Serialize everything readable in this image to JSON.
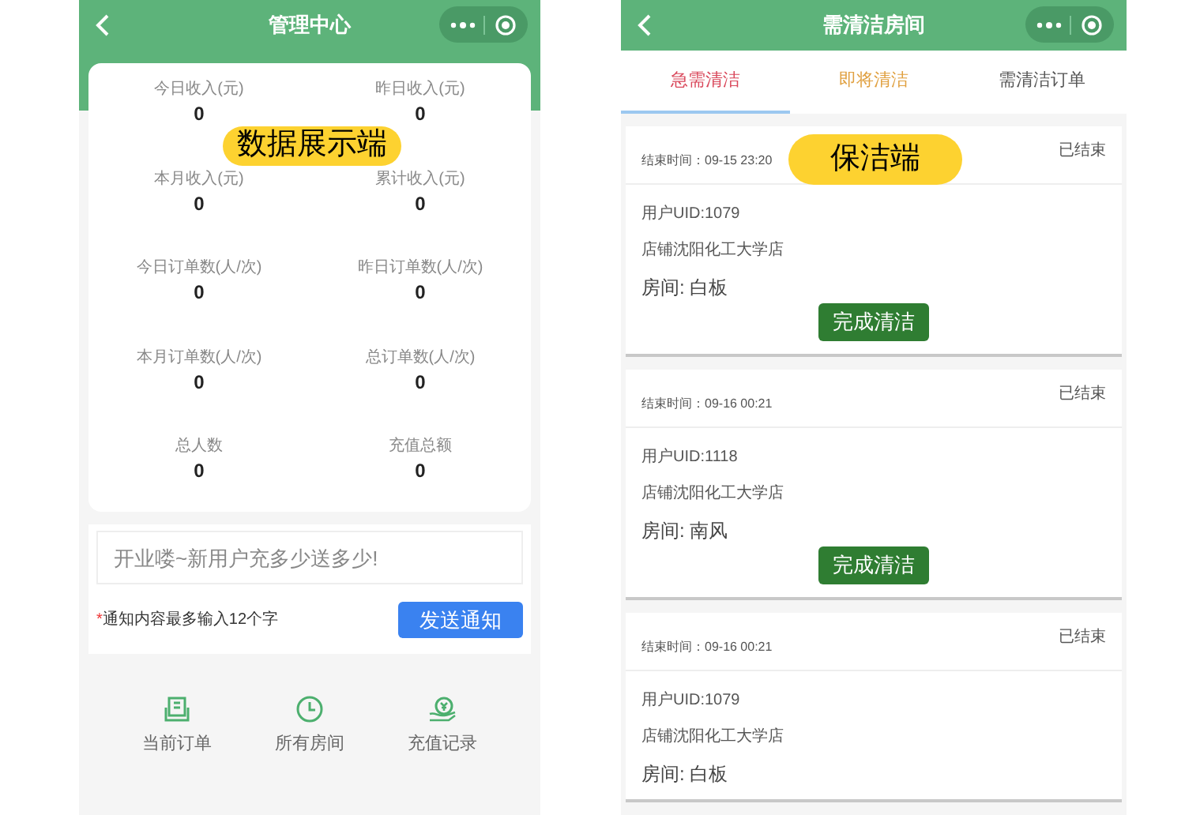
{
  "admin_screen": {
    "title": "管理中心",
    "badge": "数据展示端",
    "stats": [
      {
        "label": "今日收入(元)",
        "value": "0"
      },
      {
        "label": "昨日收入(元)",
        "value": "0"
      },
      {
        "label": "本月收入(元)",
        "value": "0"
      },
      {
        "label": "累计收入(元)",
        "value": "0"
      },
      {
        "label": "今日订单数(人/次)",
        "value": "0"
      },
      {
        "label": "昨日订单数(人/次)",
        "value": "0"
      },
      {
        "label": "本月订单数(人/次)",
        "value": "0"
      },
      {
        "label": "总订单数(人/次)",
        "value": "0"
      },
      {
        "label": "总人数",
        "value": "0"
      },
      {
        "label": "充值总额",
        "value": "0"
      }
    ],
    "notice": {
      "placeholder": "开业喽~新用户充多少送多少!",
      "required_mark": "*",
      "hint": "通知内容最多输入12个字",
      "button": "发送通知"
    },
    "nav": [
      {
        "kind": "orders",
        "label": "当前订单"
      },
      {
        "kind": "rooms",
        "label": "所有房间"
      },
      {
        "kind": "recharge",
        "label": "充值记录"
      }
    ]
  },
  "cleaner_screen": {
    "title": "需清洁房间",
    "badge": "保洁端",
    "tabs": [
      {
        "label": "急需清洁",
        "selected": true,
        "color": "#d9475a"
      },
      {
        "label": "即将清洁",
        "selected": false,
        "color": "#e0a040"
      },
      {
        "label": "需清洁订单",
        "selected": false,
        "color": "#555555"
      }
    ],
    "orders": [
      {
        "end_time": "结束时间：09-15 23:20",
        "status": "已结束",
        "uid": "用户UID:1079",
        "store": "店铺沈阳化工大学店",
        "room": "房间: 白板",
        "button": "完成清洁"
      },
      {
        "end_time": "结束时间：09-16 00:21",
        "status": "已结束",
        "uid": "用户UID:1118",
        "store": "店铺沈阳化工大学店",
        "room": "房间: 南风",
        "button": "完成清洁"
      },
      {
        "end_time": "结束时间：09-16 00:21",
        "status": "已结束",
        "uid": "用户UID:1079",
        "store": "店铺沈阳化工大学店",
        "room": "房间: 白板"
      }
    ]
  }
}
